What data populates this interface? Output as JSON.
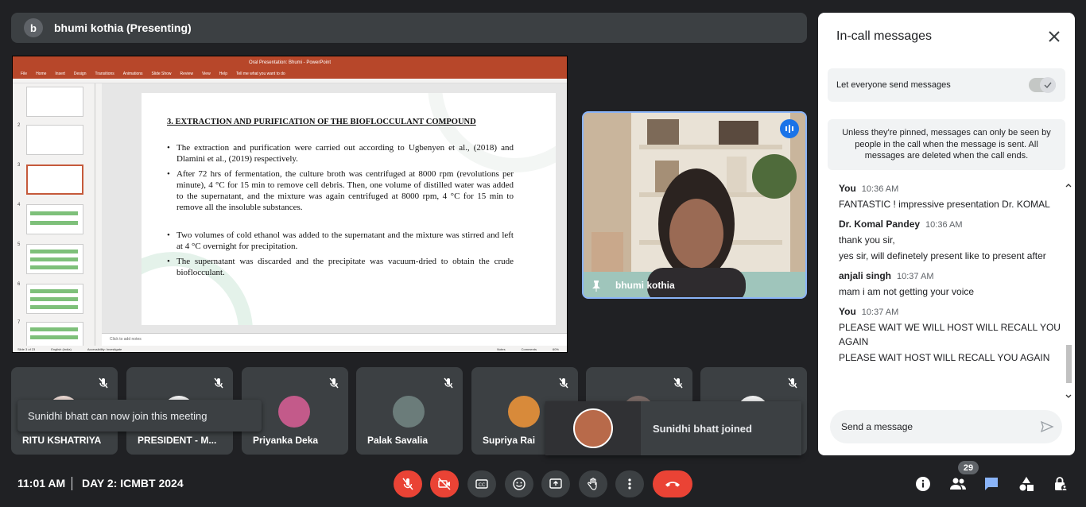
{
  "presenter": {
    "initial": "b",
    "label": "bhumi kothia (Presenting)"
  },
  "ppt": {
    "window_title": "Oral Presentation: Bhumi  -  PowerPoint",
    "ribbon_tabs": [
      "File",
      "Home",
      "Insert",
      "Design",
      "Transitions",
      "Animations",
      "Slide Show",
      "Review",
      "View",
      "Help",
      "Tell me what you want to do"
    ],
    "thumb_numbers": [
      "2",
      "3",
      "4",
      "5",
      "6",
      "7"
    ],
    "notes_placeholder": "Click to add notes",
    "status": {
      "slide": "Slide 3 of 23",
      "lang": "English (India)",
      "accessibility": "Accessibility: Investigate",
      "notes": "Notes",
      "comments": "Comments",
      "zoom": "60%"
    }
  },
  "slide": {
    "heading": "3. EXTRACTION AND PURIFICATION OF THE BIOFLOCCULANT COMPOUND",
    "bullets": [
      "The extraction and purification were carried out according to Ugbenyen et al., (2018) and Dlamini et al., (2019) respectively.",
      "After 72 hrs of fermentation, the culture broth was centrifuged at 8000 rpm (revolutions per minute), 4 °C for 15 min to remove cell debris. Then, one volume of distilled water was added to the supernatant, and the mixture was again centrifuged at 8000 rpm, 4 °C for 15 min to remove all the insoluble substances.",
      "Two volumes of cold ethanol was added to the supernatant and the mixture was stirred and left at 4 °C overnight for precipitation.",
      "The supernatant was discarded and the precipitate was vacuum-dried to obtain the crude bioflocculant."
    ]
  },
  "self_tile": {
    "name": "bhumi kothia"
  },
  "tiles": [
    {
      "name": "RITU KSHATRIYA"
    },
    {
      "name": "PRESIDENT - M..."
    },
    {
      "name": "Priyanka Deka"
    },
    {
      "name": "Palak Savalia"
    },
    {
      "name": "Supriya Rai"
    },
    {
      "name": ""
    },
    {
      "name": ""
    }
  ],
  "toast": "Sunidhi bhatt can now join this meeting",
  "joined": "Sunidhi bhatt joined",
  "chat": {
    "title": "In-call messages",
    "let_everyone": "Let everyone send messages",
    "toggle_on": true,
    "info": "Unless they're pinned, messages can only be seen by people in the call when the message is sent. All messages are deleted when the call ends.",
    "messages": [
      {
        "sender": "You",
        "time": "10:36 AM",
        "lines": [
          "FANTASTIC ! impressive presentation Dr. KOMAL"
        ]
      },
      {
        "sender": "Dr. Komal Pandey",
        "time": "10:36 AM",
        "lines": [
          "thank you sir,",
          "yes sir, will definetely present like to present after"
        ]
      },
      {
        "sender": "anjali singh",
        "time": "10:37 AM",
        "lines": [
          "mam i am not getting your voice"
        ]
      },
      {
        "sender": "You",
        "time": "10:37 AM",
        "lines": [
          "PLEASE WAIT WE WILL HOST WILL RECALL YOU AGAIN",
          "PLEASE WAIT  HOST WILL RECALL YOU AGAIN"
        ]
      }
    ],
    "send_placeholder": "Send a message"
  },
  "bottom": {
    "time": "11:01 AM",
    "meeting": "DAY 2: ICMBT 2024",
    "participants_count": "29"
  },
  "colors": {
    "accent": "#8ab4f8",
    "danger": "#ea4335",
    "bg": "#202124",
    "tile": "#3c4043"
  }
}
